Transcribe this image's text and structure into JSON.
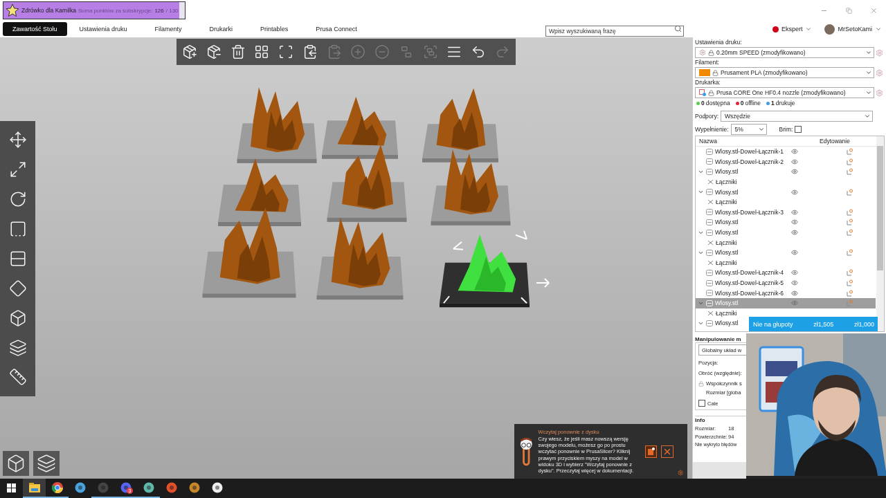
{
  "stream_alert": {
    "title": "Zdrówko dla Kamilka",
    "label": "Suma punktów za subskrypcje:",
    "current": "126",
    "goal": "/ 130",
    "level": 0.97
  },
  "tabs": [
    {
      "label": "Zawartość Stołu",
      "selected": true
    },
    {
      "label": "Ustawienia druku",
      "selected": false
    },
    {
      "label": "Filamenty",
      "selected": false
    },
    {
      "label": "Drukarki",
      "selected": false
    },
    {
      "label": "Printables",
      "selected": false
    },
    {
      "label": "Prusa Connect",
      "selected": false
    }
  ],
  "search": {
    "placeholder": "Wpisz wyszukiwaną frazę"
  },
  "mode": {
    "label": "Ekspert",
    "color": "#d0021b"
  },
  "user": {
    "name": "MrSetoKami"
  },
  "toolbar": [
    {
      "disabled": false
    },
    {
      "disabled": false
    },
    {
      "disabled": false
    },
    {
      "disabled": false
    },
    {
      "disabled": false
    },
    {
      "disabled": false
    },
    {
      "disabled": true
    },
    {
      "disabled": true
    },
    {
      "disabled": true
    },
    {
      "disabled": true
    },
    {
      "disabled": true
    },
    {
      "disabled": false
    },
    {
      "disabled": false
    },
    {
      "disabled": true
    }
  ],
  "scene": {
    "beds": [
      {
        "selected": false
      },
      {
        "selected": false
      },
      {
        "selected": false
      },
      {
        "selected": false
      },
      {
        "selected": false
      },
      {
        "selected": false
      },
      {
        "selected": false
      },
      {
        "selected": false
      },
      {
        "selected": true
      }
    ]
  },
  "settings": {
    "print": {
      "label": "Ustawienia druku:",
      "value": "0.20mm SPEED (zmodyfikowano)"
    },
    "filament": {
      "label": "Filament:",
      "value": "Prusament PLA (zmodyfikowano)",
      "color": "#f08a00"
    },
    "printer": {
      "label": "Drukarka:",
      "value": "Prusa CORE One HF0.4 nozzle (zmodyfikowano)"
    },
    "printer_status": [
      {
        "count": "0",
        "label": "dostępna",
        "color": "#5bd04a"
      },
      {
        "count": "0",
        "label": "offline",
        "color": "#e0243c"
      },
      {
        "count": "1",
        "label": "drukuje",
        "color": "#3b9ee8"
      }
    ],
    "supports": {
      "label": "Podpory:",
      "value": "Wszędzie"
    },
    "infill": {
      "label": "Wypełnienie:",
      "value": "5%"
    },
    "brim": {
      "label": "Brim:",
      "checked": false
    }
  },
  "object_list": {
    "columns": [
      "Nazwa",
      "Edytowanie"
    ],
    "rows": [
      {
        "name": "Wlosy.stl-Dowel-Łącznik-1",
        "selected": false
      },
      {
        "name": "Wlosy.stl-Dowel-Łącznik-2",
        "selected": false
      },
      {
        "name": "Wlosy.stl",
        "selected": false,
        "expanded": true,
        "children": [
          {
            "name": "Łączniki"
          }
        ]
      },
      {
        "name": "Wlosy.stl",
        "selected": false,
        "expanded": true,
        "children": [
          {
            "name": "Łączniki"
          }
        ]
      },
      {
        "name": "Wlosy.stl-Dowel-Łącznik-3",
        "selected": false
      },
      {
        "name": "Wlosy.stl",
        "selected": false
      },
      {
        "name": "Wlosy.stl",
        "selected": false,
        "expanded": true,
        "children": [
          {
            "name": "Łączniki"
          }
        ]
      },
      {
        "name": "Wlosy.stl",
        "selected": false,
        "expanded": true,
        "children": [
          {
            "name": "Łączniki"
          }
        ]
      },
      {
        "name": "Wlosy.stl-Dowel-Łącznik-4",
        "selected": false
      },
      {
        "name": "Wlosy.stl-Dowel-Łącznik-5",
        "selected": false
      },
      {
        "name": "Wlosy.stl-Dowel-Łącznik-6",
        "selected": false
      },
      {
        "name": "Wlosy.stl",
        "selected": true,
        "expanded": true,
        "children": [
          {
            "name": "Łączniki"
          }
        ]
      },
      {
        "name": "Wlosy.stl",
        "selected": false,
        "expanded": true
      }
    ]
  },
  "goal_overlay": {
    "name": "Nie na głupoty",
    "current": "zł1,505",
    "target": "zł1,000"
  },
  "manipulation": {
    "title": "Manipulowanie m",
    "coordinates": "Globalny układ w",
    "position": "Pozycja:",
    "rotate": "Obróć (względnie):",
    "scale": "Współczynnik s",
    "size": "Rozmiar [globa",
    "inches": {
      "label": "Cale",
      "checked": false
    }
  },
  "info": {
    "title": "Info",
    "rows": [
      {
        "label": "Rozmiar:",
        "value": "18"
      },
      {
        "label": "Powierzchnie:",
        "value": "94"
      }
    ],
    "status": "Nie wykryto błędów"
  },
  "notification": {
    "title": "Wczytaj ponownie z dysku",
    "body": "Czy wiesz, że jeśli masz nowszą wersję swojego modelu, możesz go po prostu wczytać ponownie w PrusaSlicer? Kliknij prawym przyciskiem myszy na model w widoku 3D i wybierz \"Wczytaj ponownie z dysku\". Przeczytaj więcej w dokumentacji."
  },
  "taskbar": {
    "apps": [
      {
        "running": true,
        "selected": true
      },
      {
        "running": true,
        "selected": false
      },
      {
        "running": false,
        "selected": false
      },
      {
        "running": true,
        "selected": false
      },
      {
        "running": true,
        "selected": false,
        "badge": "3"
      },
      {
        "running": true,
        "selected": false
      },
      {
        "running": false,
        "selected": false
      },
      {
        "running": false,
        "selected": false
      },
      {
        "running": false,
        "selected": false
      }
    ]
  }
}
